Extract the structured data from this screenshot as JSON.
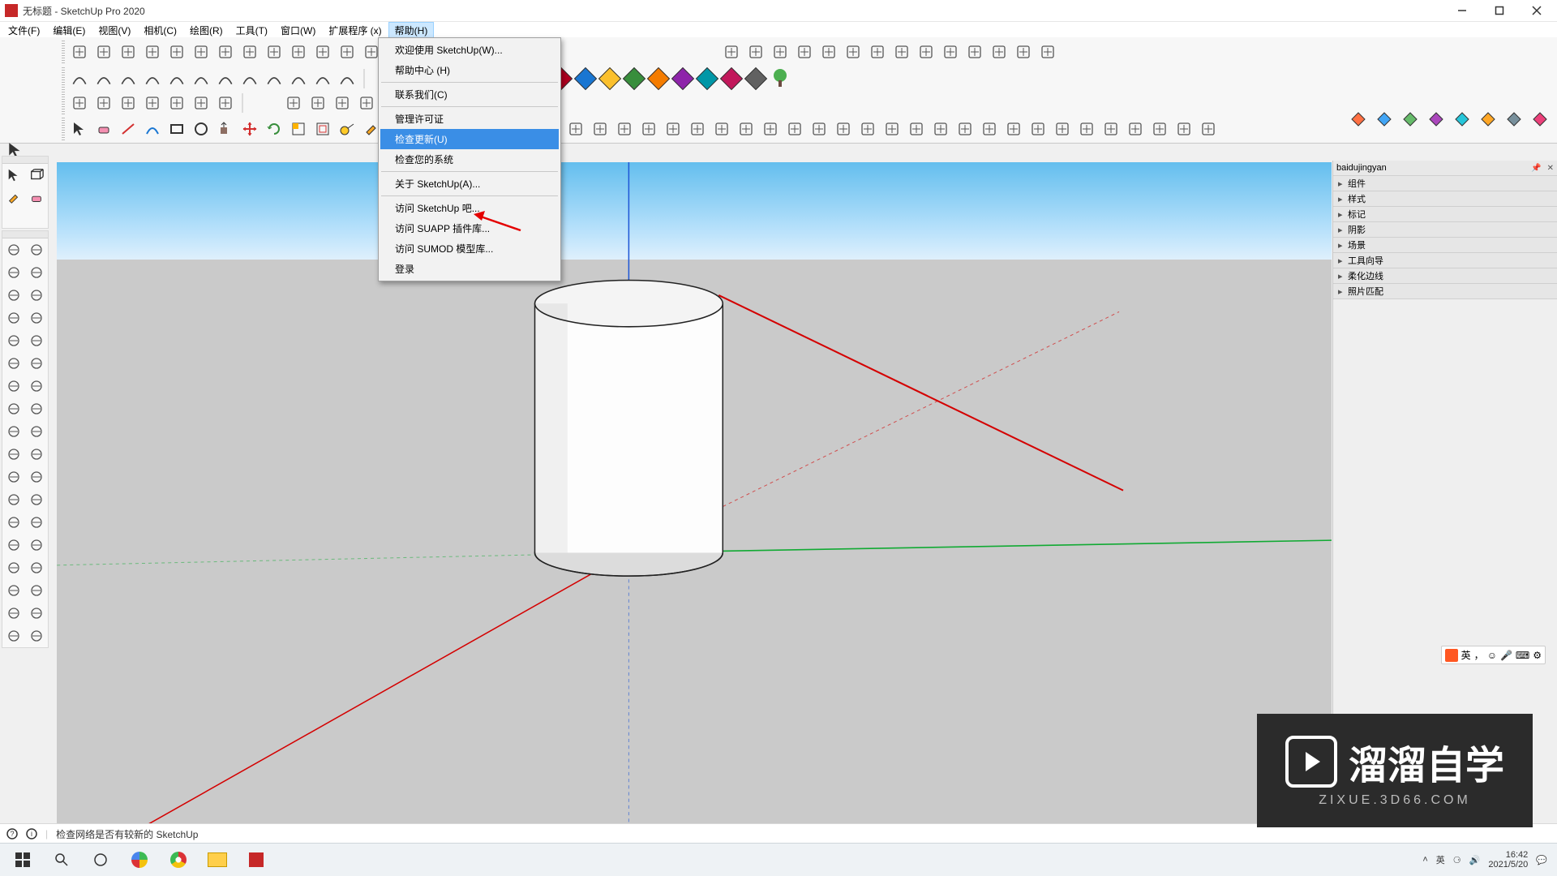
{
  "window": {
    "title": "无标题 - SketchUp Pro 2020",
    "minimize": "–",
    "maximize": "□",
    "close": "✕"
  },
  "menubar": {
    "items": [
      "文件(F)",
      "编辑(E)",
      "视图(V)",
      "相机(C)",
      "绘图(R)",
      "工具(T)",
      "窗口(W)",
      "扩展程序 (x)",
      "帮助(H)"
    ],
    "active_index": 8
  },
  "help_menu": {
    "items": [
      {
        "label": "欢迎使用 SketchUp(W)..."
      },
      {
        "label": "帮助中心 (H)"
      },
      {
        "sep": true
      },
      {
        "label": "联系我们(C)"
      },
      {
        "sep": true
      },
      {
        "label": "管理许可证"
      },
      {
        "label": "检查更新(U)",
        "highlight": true
      },
      {
        "label": "检查您的系统"
      },
      {
        "sep": true
      },
      {
        "label": "关于 SketchUp(A)..."
      },
      {
        "sep": true
      },
      {
        "label": "访问 SketchUp 吧..."
      },
      {
        "label": "访问 SUAPP 插件库..."
      },
      {
        "label": "访问 SUMOD 模型库..."
      },
      {
        "label": "登录"
      }
    ]
  },
  "right_panel": {
    "header": "baidujingyan",
    "trays": [
      "组件",
      "样式",
      "标记",
      "阴影",
      "场景",
      "工具向导",
      "柔化边线",
      "照片匹配"
    ]
  },
  "status": {
    "text": "检查网络是否有较新的 SketchUp"
  },
  "ime": {
    "lang": "英",
    "punct": "，",
    "icons": [
      "☺",
      "🎤",
      "⌨",
      "⚙"
    ]
  },
  "watermark": {
    "big": "溜溜自学",
    "small": "ZIXUE.3D66.COM"
  },
  "taskbar": {
    "time": "16:42",
    "date": "2021/5/20"
  },
  "diamond_colors": [
    "#b00020",
    "#1976d2",
    "#fbc02d",
    "#388e3c",
    "#f57c00",
    "#8e24aa",
    "#0097a7",
    "#c2185b",
    "#616161"
  ],
  "toolbar_icons_row1": [
    "select-rect",
    "lasso",
    "shape",
    "poly",
    "curve",
    "sandbox",
    "offset",
    "revolve",
    "loft",
    "sweep",
    "extrude",
    "intersect",
    "boolean",
    "measure",
    "protractor",
    "text",
    "dim",
    "axes",
    "section"
  ],
  "toolbar_icons_row1b": [
    "iso",
    "top",
    "front",
    "right",
    "back",
    "left",
    "persp",
    "walk",
    "look",
    "zoom-ext",
    "pan",
    "orbit",
    "prev",
    "next"
  ],
  "toolbar_icons_row2": [
    "line",
    "freehand",
    "arc",
    "arc2",
    "circle",
    "rect",
    "rotated",
    "pie",
    "poly2",
    "3pt",
    "bezier",
    "tangent"
  ],
  "toolbar_icons_row3": [
    "comp-make",
    "comp-edit",
    "find",
    "replace",
    "tag",
    "eye",
    "eye-off"
  ],
  "toolbar_icons_row3_right": [
    "undo",
    "redo",
    "cut",
    "copy",
    "paste"
  ],
  "main_tools": [
    "pointer",
    "eraser",
    "line2",
    "arc3",
    "rect2",
    "circle2",
    "pushpull",
    "move",
    "rotate",
    "scale",
    "offset2",
    "tape",
    "paint",
    "orbit2",
    "pan2",
    "zoom",
    "zoom-ext2"
  ],
  "right_cluster_icons": [
    "layer1",
    "layer2",
    "layer3",
    "globe",
    "solid1",
    "solid2",
    "solid3",
    "solid4"
  ],
  "main_tools_extra": [
    "box",
    "cone",
    "sphere",
    "torus",
    "prism",
    "dome",
    "group1",
    "group2",
    "group3",
    "group4",
    "house1",
    "house2",
    "house3",
    "house4",
    "house5",
    "doc1",
    "doc2",
    "doc3",
    "doc4",
    "book1",
    "book2",
    "book3",
    "book4",
    "star1",
    "star2",
    "star3",
    "ring",
    "shield",
    "tag2",
    "gear"
  ]
}
